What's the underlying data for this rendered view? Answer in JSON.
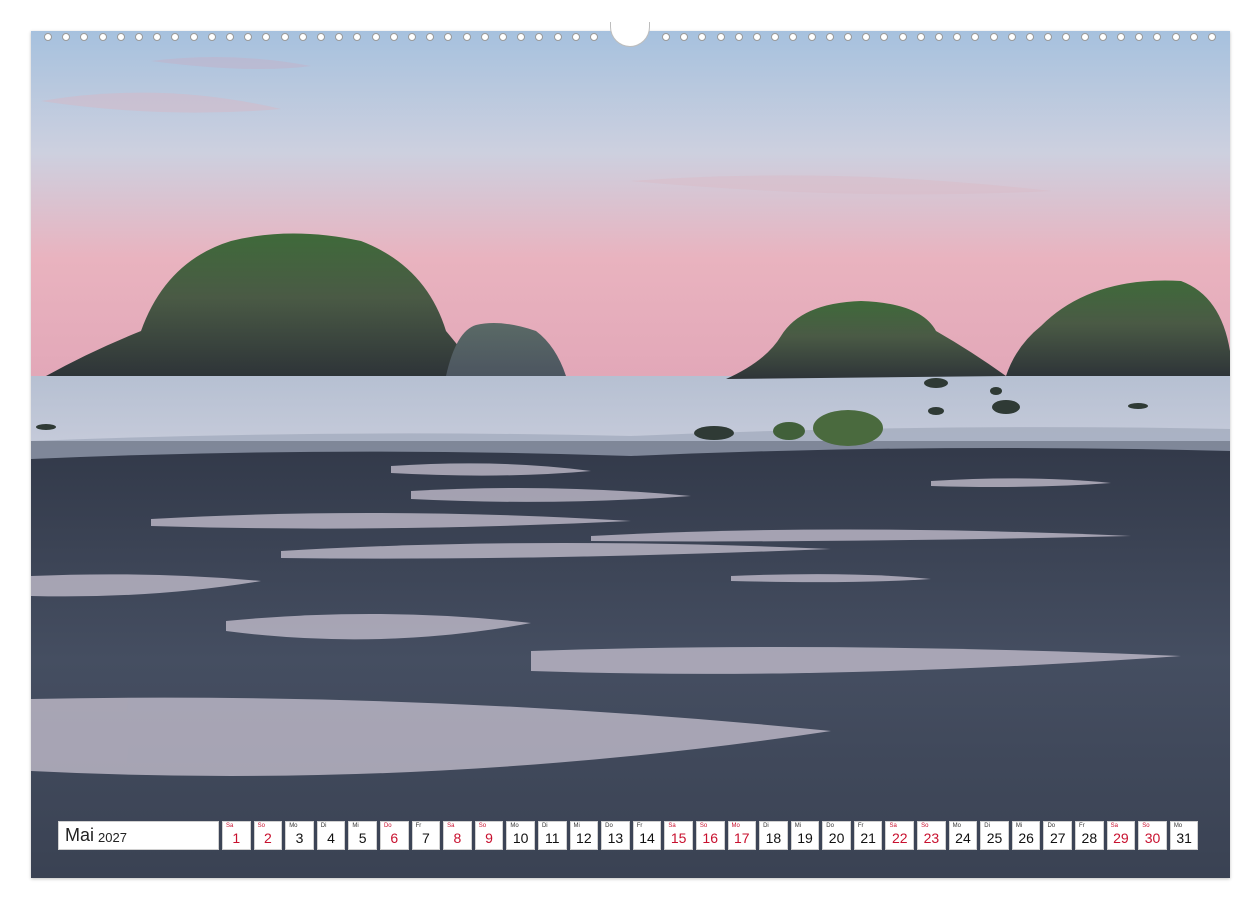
{
  "calendar": {
    "month": "Mai",
    "year": "2027",
    "days": [
      {
        "wd": "Sa",
        "n": "1",
        "we": true
      },
      {
        "wd": "So",
        "n": "2",
        "we": true
      },
      {
        "wd": "Mo",
        "n": "3",
        "we": false
      },
      {
        "wd": "Di",
        "n": "4",
        "we": false
      },
      {
        "wd": "Mi",
        "n": "5",
        "we": false
      },
      {
        "wd": "Do",
        "n": "6",
        "we": true
      },
      {
        "wd": "Fr",
        "n": "7",
        "we": false
      },
      {
        "wd": "Sa",
        "n": "8",
        "we": true
      },
      {
        "wd": "So",
        "n": "9",
        "we": true
      },
      {
        "wd": "Mo",
        "n": "10",
        "we": false
      },
      {
        "wd": "Di",
        "n": "11",
        "we": false
      },
      {
        "wd": "Mi",
        "n": "12",
        "we": false
      },
      {
        "wd": "Do",
        "n": "13",
        "we": false
      },
      {
        "wd": "Fr",
        "n": "14",
        "we": false
      },
      {
        "wd": "Sa",
        "n": "15",
        "we": true
      },
      {
        "wd": "So",
        "n": "16",
        "we": true
      },
      {
        "wd": "Mo",
        "n": "17",
        "we": true
      },
      {
        "wd": "Di",
        "n": "18",
        "we": false
      },
      {
        "wd": "Mi",
        "n": "19",
        "we": false
      },
      {
        "wd": "Do",
        "n": "20",
        "we": false
      },
      {
        "wd": "Fr",
        "n": "21",
        "we": false
      },
      {
        "wd": "Sa",
        "n": "22",
        "we": true
      },
      {
        "wd": "So",
        "n": "23",
        "we": true
      },
      {
        "wd": "Mo",
        "n": "24",
        "we": false
      },
      {
        "wd": "Di",
        "n": "25",
        "we": false
      },
      {
        "wd": "Mi",
        "n": "26",
        "we": false
      },
      {
        "wd": "Do",
        "n": "27",
        "we": false
      },
      {
        "wd": "Fr",
        "n": "28",
        "we": false
      },
      {
        "wd": "Sa",
        "n": "29",
        "we": true
      },
      {
        "wd": "So",
        "n": "30",
        "we": true
      },
      {
        "wd": "Mo",
        "n": "31",
        "we": false
      }
    ]
  },
  "colors": {
    "weekend": "#c8102e",
    "sky_top": "#a9c3df",
    "sky_bottom": "#e7a9b7",
    "sand": "#3e4657"
  }
}
